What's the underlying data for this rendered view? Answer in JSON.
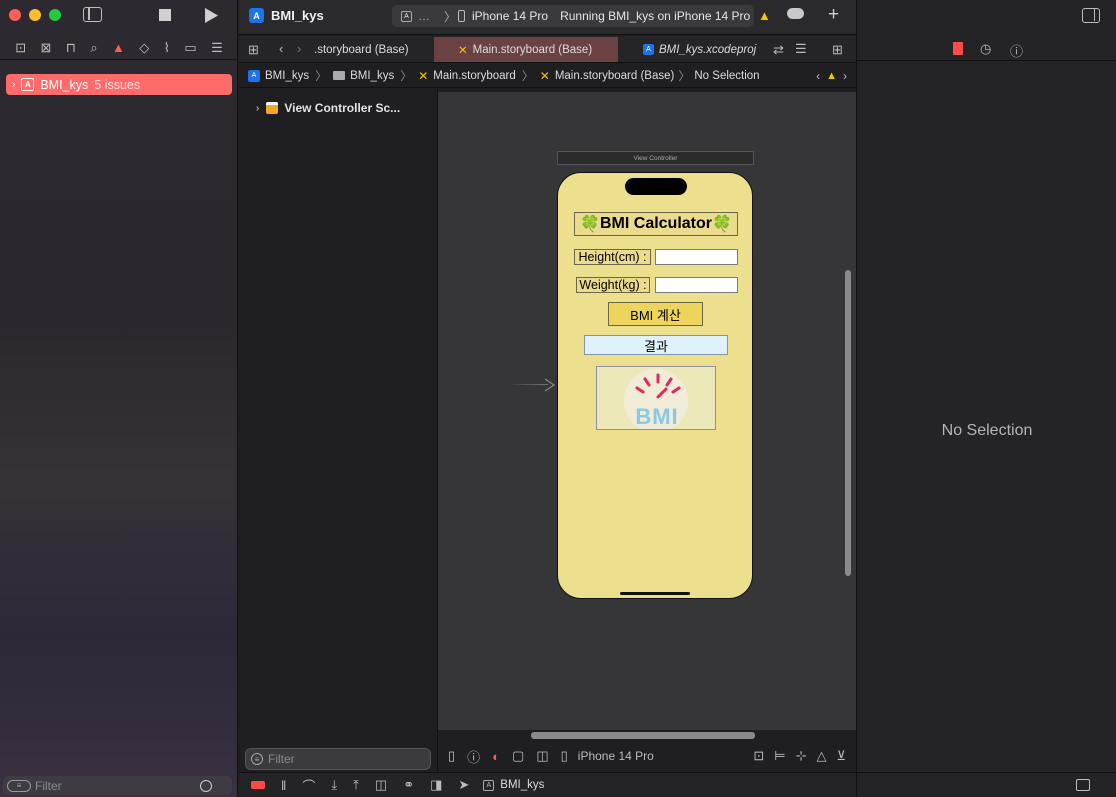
{
  "project": {
    "name": "BMI_kys",
    "issues_label": "5 issues"
  },
  "toolbar": {
    "device": "iPhone 14 Pro",
    "status": "Running BMI_kys on iPhone 14 Pro"
  },
  "tabs": [
    {
      "label": ".storyboard (Base)"
    },
    {
      "label": "Main.storyboard (Base)"
    },
    {
      "label": "BMI_kys.xcodeproj"
    }
  ],
  "breadcrumb": [
    "BMI_kys",
    "BMI_kys",
    "Main.storyboard",
    "Main.storyboard (Base)",
    "No Selection"
  ],
  "outline": {
    "item": "View Controller Sc...",
    "filter_placeholder": "Filter"
  },
  "navigator": {
    "filter_placeholder": "Filter"
  },
  "scene": {
    "title": "View Controller",
    "app_title": "BMI Calculator",
    "clover": "🍀",
    "height_label": "Height(cm) :",
    "weight_label": "Weight(kg) :",
    "button_label": "BMI 계산",
    "result_label": "결과",
    "image_text": "BMI"
  },
  "bottom_bar": {
    "device": "iPhone 14 Pro",
    "debug_target": "BMI_kys"
  },
  "inspector": {
    "empty_label": "No Selection"
  },
  "colors": {
    "accent": "#ff6262",
    "phone_bg": "#ecdf8e",
    "selected_tab": "#6b4244"
  }
}
